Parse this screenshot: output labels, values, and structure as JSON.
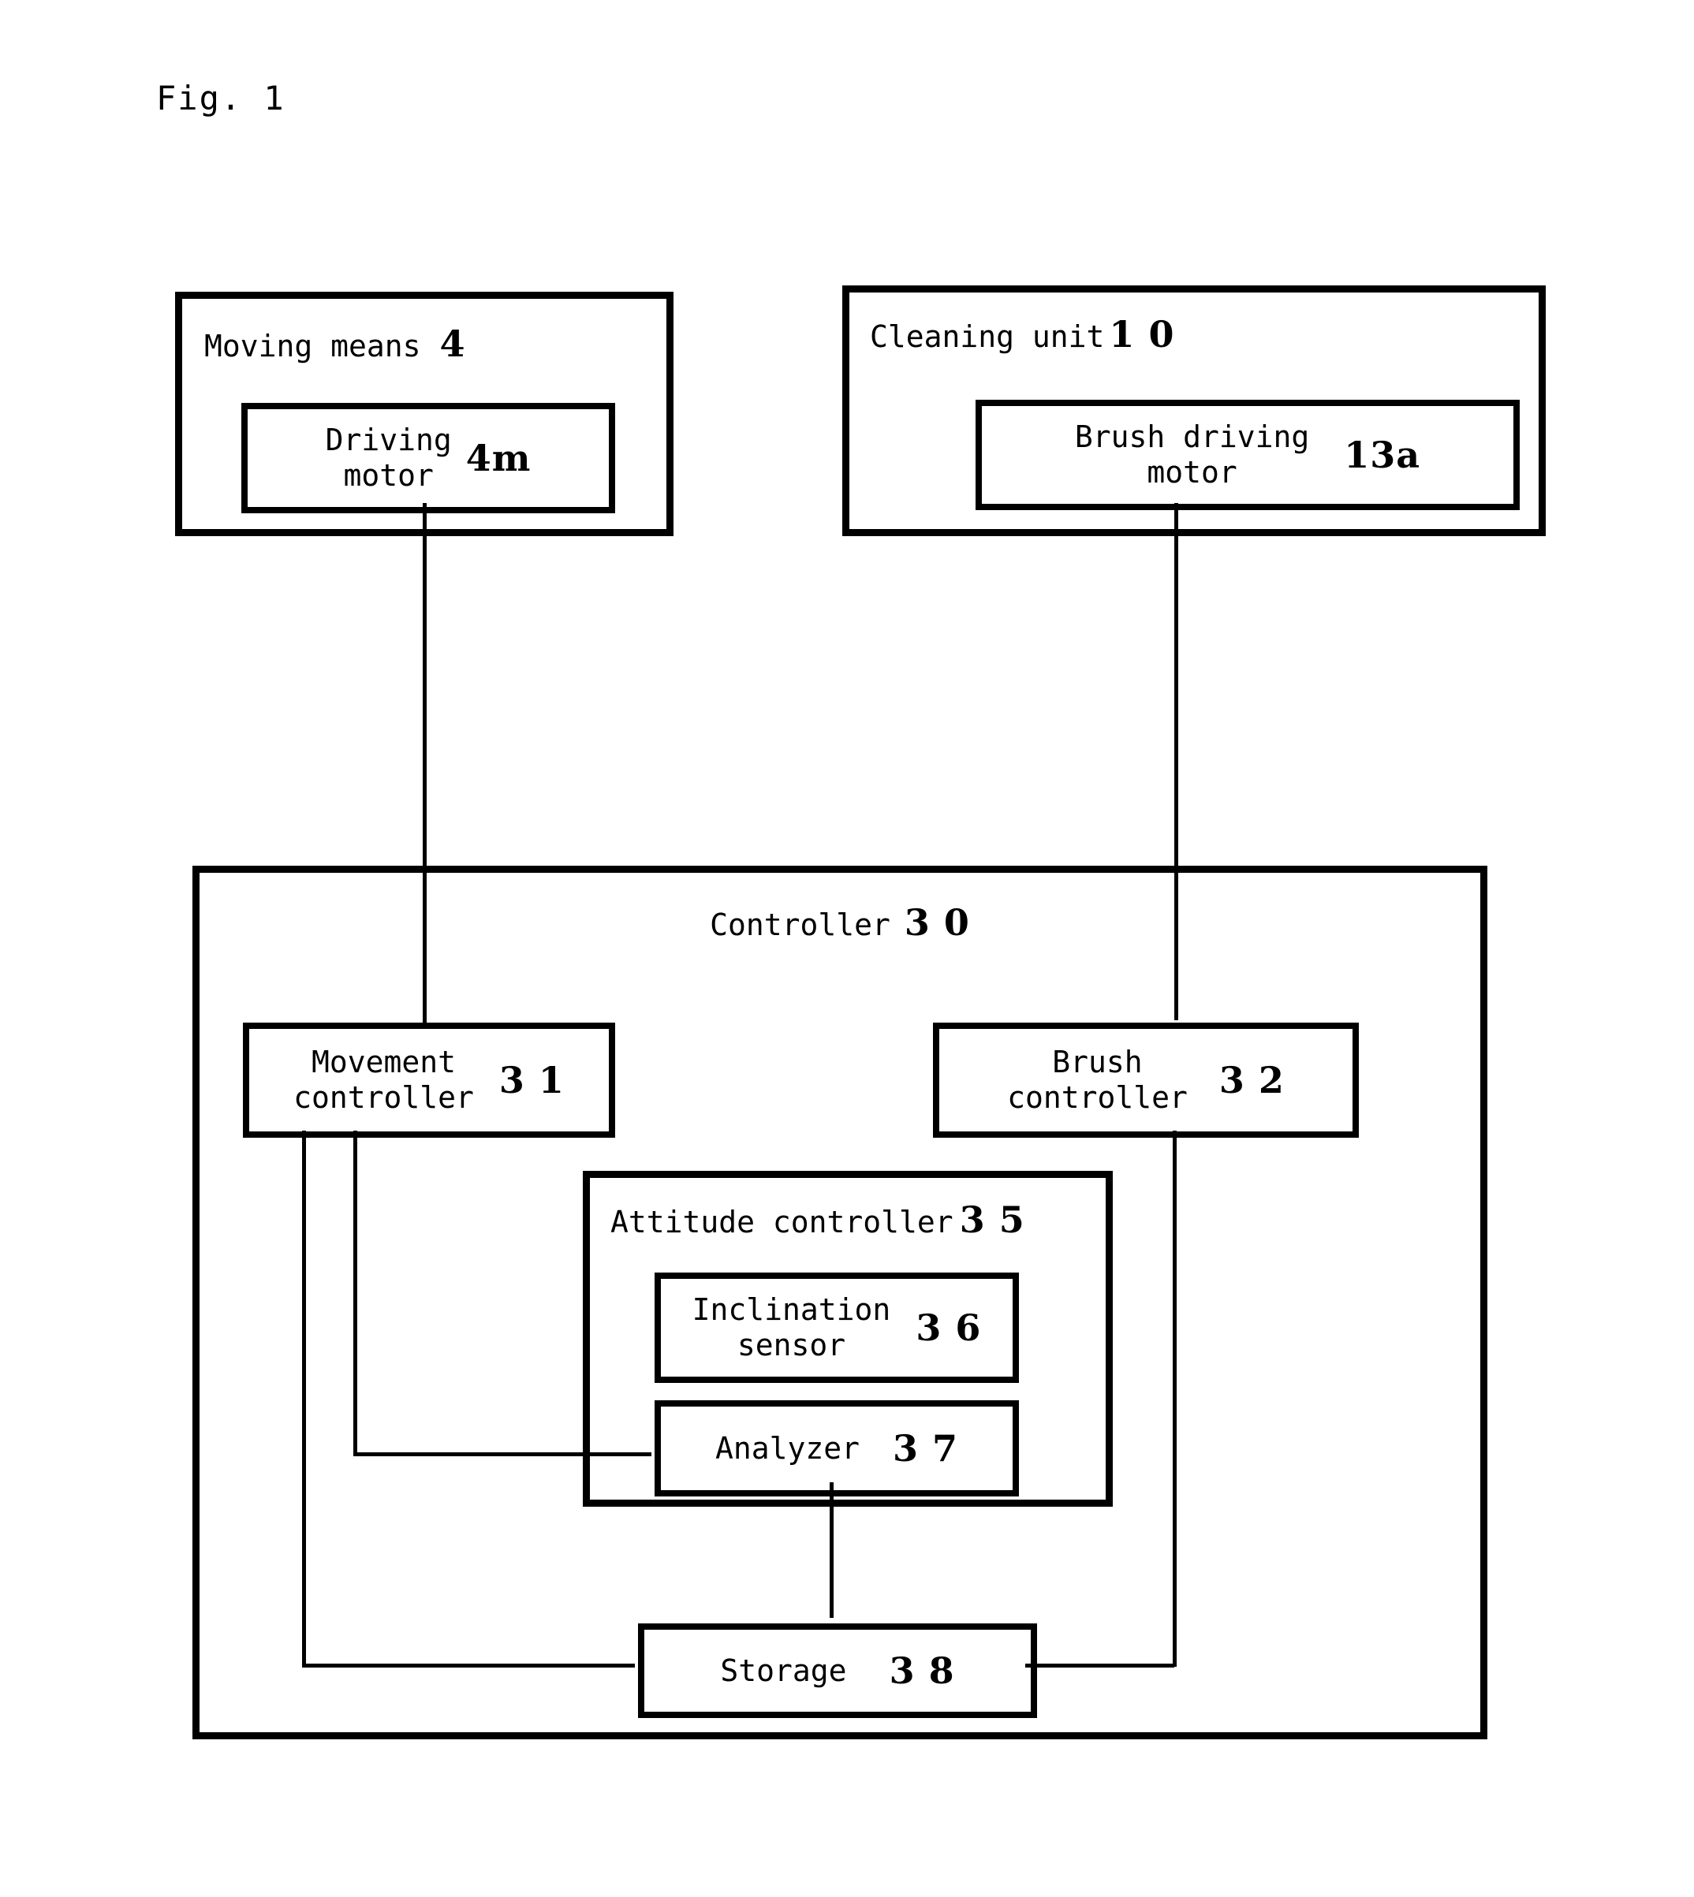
{
  "figure": {
    "label": "Fig. 1",
    "type": "patent block diagram"
  },
  "blocks": {
    "moving_means": {
      "title": "Moving means",
      "ref": "4",
      "child": {
        "label": "Driving\nmotor",
        "ref": "4m"
      }
    },
    "cleaning_unit": {
      "title": "Cleaning unit",
      "ref": "1 0",
      "child": {
        "label": "Brush driving\nmotor",
        "ref": "13a"
      }
    },
    "controller": {
      "title": "Controller",
      "ref": "3 0",
      "movement_controller": {
        "label": "Movement\ncontroller",
        "ref": "3 1"
      },
      "brush_controller": {
        "label": "Brush\ncontroller",
        "ref": "3 2"
      },
      "attitude_controller": {
        "title": "Attitude controller",
        "ref": "3 5",
        "inclination_sensor": {
          "label": "Inclination\nsensor",
          "ref": "3 6"
        },
        "analyzer": {
          "label": "Analyzer",
          "ref": "3 7"
        }
      },
      "storage": {
        "label": "Storage",
        "ref": "3 8"
      }
    }
  },
  "colors": {
    "stroke": "#000000",
    "background": "#ffffff"
  }
}
